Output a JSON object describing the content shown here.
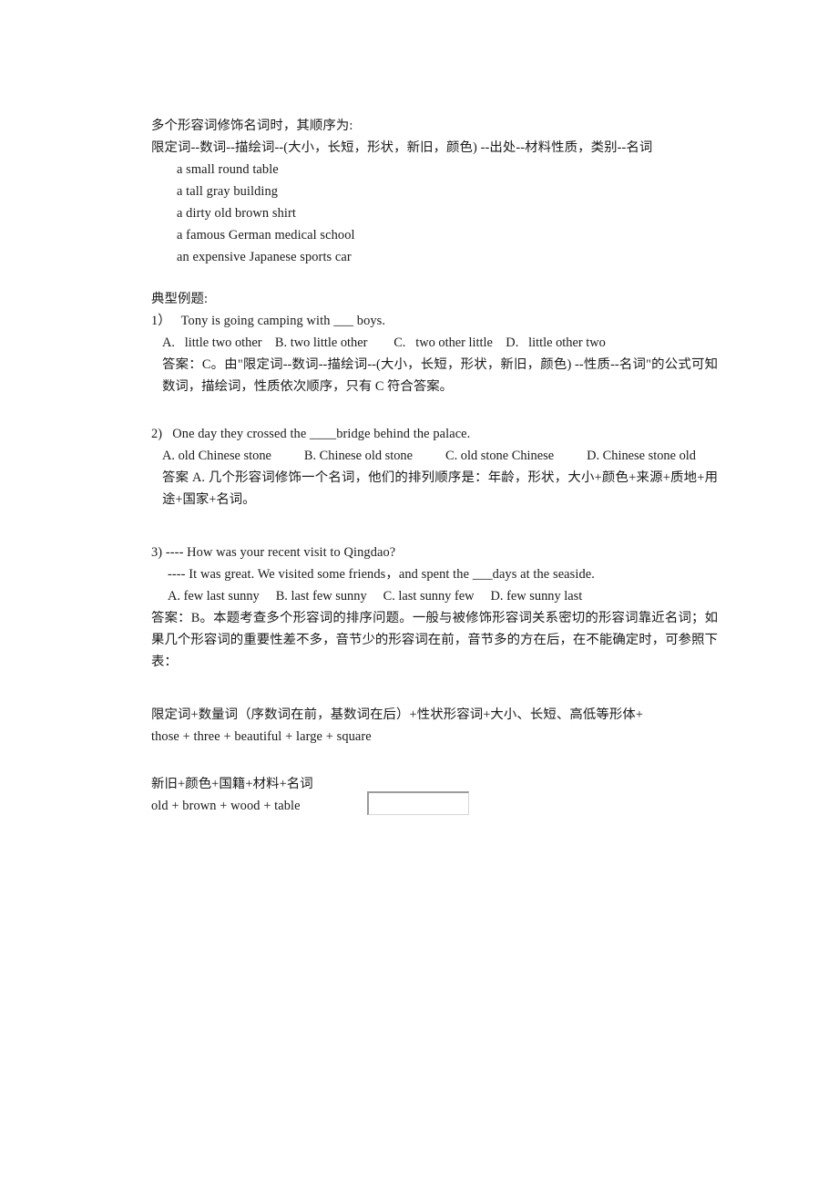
{
  "document": {
    "background_color": "#ffffff",
    "text_color": "#1a1a1a",
    "intro": {
      "rule_line": "多个形容词修饰名词时，其顺序为:",
      "order_formula": "限定词--数词--描绘词--(大小，长短，形状，新旧，颜色) --出处--材料性质，类别--名词"
    },
    "examples": [
      "a small round table",
      "a tall gray building",
      "a dirty old brown shirt",
      "a famous German medical school",
      "an expensive Japanese sports car"
    ],
    "section_heading": "典型例题:",
    "questions": [
      {
        "number": "1）",
        "stem": "Tony is going camping with ___ boys.",
        "options": "A.   little two other    B. two little other        C.   two other little    D.   little other two",
        "answer": "答案：C。由\"限定词--数词--描绘词--(大小，长短，形状，新旧，颜色) --性质--名词\"的公式可知数词，描绘词，性质依次顺序，只有 C 符合答案。"
      },
      {
        "number": "2)",
        "stem": "One day they crossed the ____bridge behind the palace.",
        "options": "A. old Chinese stone          B. Chinese old stone          C. old stone Chinese          D. Chinese stone old",
        "answer": "答案 A. 几个形容词修饰一个名词，他们的排列顺序是：年龄，形状，大小+颜色+来源+质地+用途+国家+名词。"
      },
      {
        "number": "3)",
        "stem": "---- How was your recent visit to Qingdao?",
        "stem2": "---- It was great. We visited some friends，and spent the ___days at the seaside.",
        "options": "A. few last sunny     B. last few sunny     C. last sunny few     D. few sunny last",
        "answer": "答案：B。本题考查多个形容词的排序问题。一般与被修饰形容词关系密切的形容词靠近名词；如果几个形容词的重要性差不多，音节少的形容词在前，音节多的方在后，在不能确定时，可参照下表："
      }
    ],
    "tables": [
      {
        "formula": "限定词+数量词（序数词在前，基数词在后）+性状形容词+大小、长短、高低等形体+",
        "example": "those + three + beautiful + large + square"
      },
      {
        "formula": "新旧+颜色+国籍+材料+名词",
        "example": "old + brown + wood + table"
      }
    ],
    "empty_box": {
      "label": "",
      "border_color": "#9a9a9a"
    }
  }
}
